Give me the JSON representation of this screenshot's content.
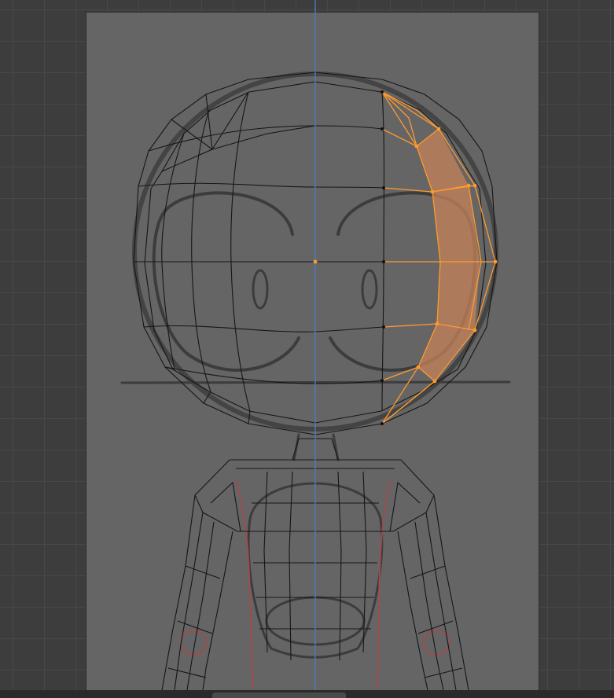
{
  "viewport": {
    "mode": "edit-mode",
    "view": "front-orthographic",
    "colors": {
      "background": "#3d3d3d",
      "grid": "#484848",
      "reference_image": "#656565",
      "wire": "#161616",
      "selection": "#ff9a2e",
      "selected_face": "#c6825a",
      "vertical_axis": "#4d7ab8",
      "sketch_red": "#a54545"
    },
    "selection": {
      "type": "face-loop",
      "selected_faces": 6
    }
  }
}
